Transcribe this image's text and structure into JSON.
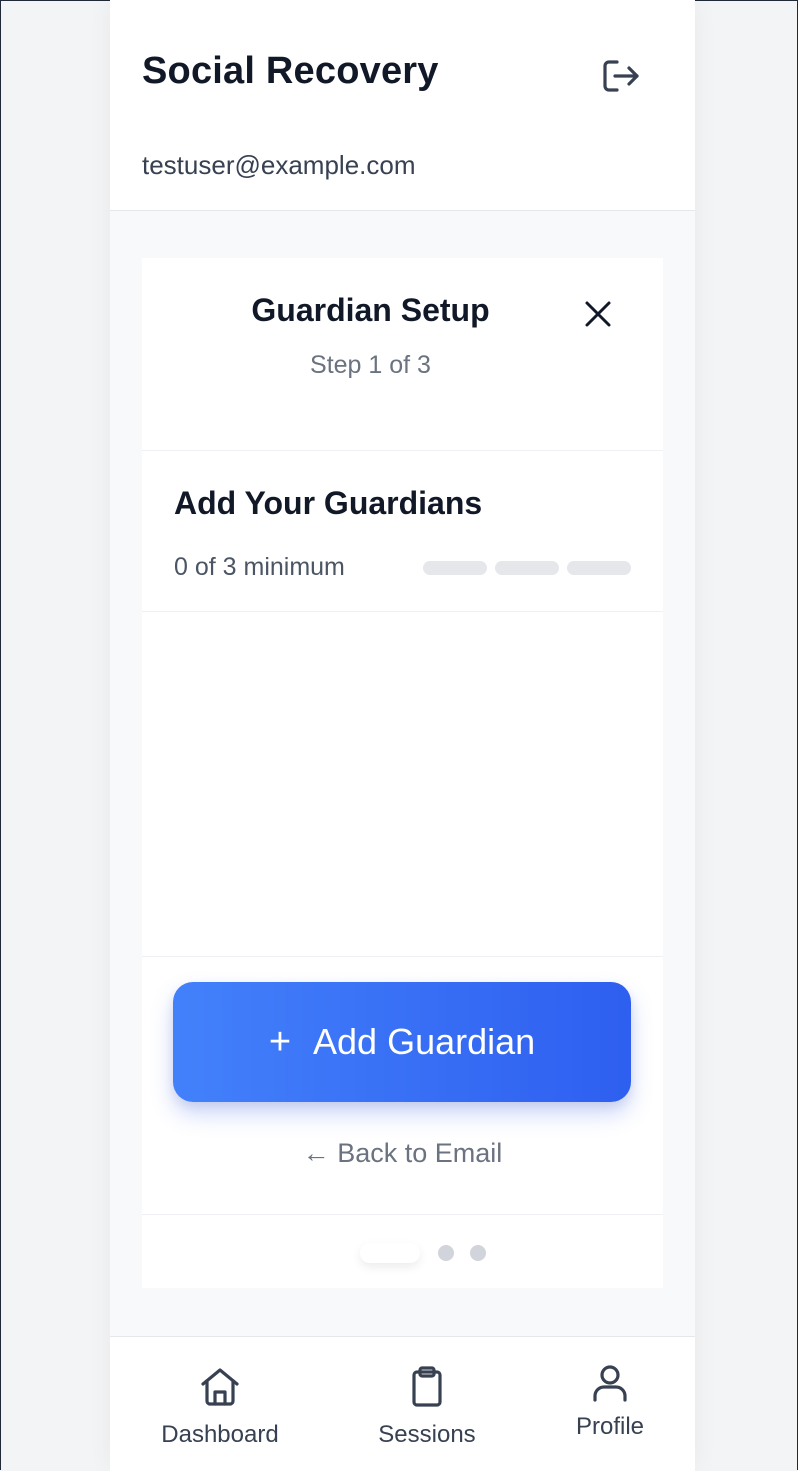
{
  "header": {
    "title": "Social Recovery",
    "email": "testuser@example.com",
    "logout_icon": "logout-icon"
  },
  "card": {
    "title": "Guardian Setup",
    "step": "Step 1 of 3",
    "close_icon": "close-icon"
  },
  "section": {
    "title": "Add Your Guardians",
    "progress_text": "0 of 3 minimum",
    "progress_filled": 0,
    "progress_total": 3
  },
  "actions": {
    "add_icon": "+",
    "add_label": "Add Guardian",
    "back_label": "← Back to Email"
  },
  "pager": {
    "current": 1,
    "total": 3
  },
  "nav": {
    "items": [
      {
        "label": "Dashboard",
        "icon": "home-icon"
      },
      {
        "label": "Sessions",
        "icon": "clipboard-icon"
      },
      {
        "label": "Profile",
        "icon": "user-icon"
      }
    ]
  },
  "colors": {
    "accent_start": "#4381fb",
    "accent_end": "#2e5ff0",
    "progress_empty": "#e5e7eb",
    "text_primary": "#111827",
    "text_muted": "#6b7280"
  }
}
